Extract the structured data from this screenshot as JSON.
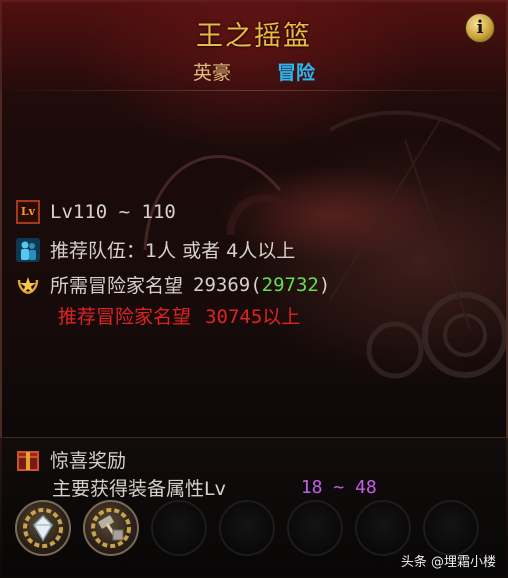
{
  "dungeon": {
    "title": "王之摇篮"
  },
  "info_button": {
    "label": "i"
  },
  "modes": [
    {
      "label": "英豪"
    },
    {
      "label": "冒险"
    }
  ],
  "level_row": {
    "icon": "level-badge-icon",
    "icon_text": "Lv",
    "text": "Lv110 ~ 110"
  },
  "party_row": {
    "icon": "party-icon",
    "text": "推荐队伍：1人 或者 4人以上"
  },
  "fame_row": {
    "icon": "fame-laurel-icon",
    "label": "所需冒险家名望",
    "value": "29369",
    "paren_open": "(",
    "current": "29732",
    "paren_close": ")"
  },
  "recommended_fame": {
    "label": "推荐冒险家名望",
    "value": "30745以上"
  },
  "rewards": {
    "icon": "gift-box-icon",
    "title": "惊喜奖励",
    "subtitle": "主要获得装备属性Lv",
    "level_range": "18 ~ 48"
  },
  "reward_slots": [
    {
      "icon": "diamond-gear-icon",
      "filled": true
    },
    {
      "icon": "hammer-box-icon",
      "filled": true
    },
    {
      "filled": false
    },
    {
      "filled": false
    },
    {
      "filled": false
    },
    {
      "filled": false
    },
    {
      "filled": false
    }
  ],
  "watermark": "头条 @埋霜小楼",
  "colors": {
    "title": "#f1b742",
    "active_tab": "#2ab8f3",
    "inactive_tab": "#e1bd7c",
    "fame_current": "#63e14b",
    "recommended": "#e12222",
    "level_range": "#c15fe8"
  }
}
